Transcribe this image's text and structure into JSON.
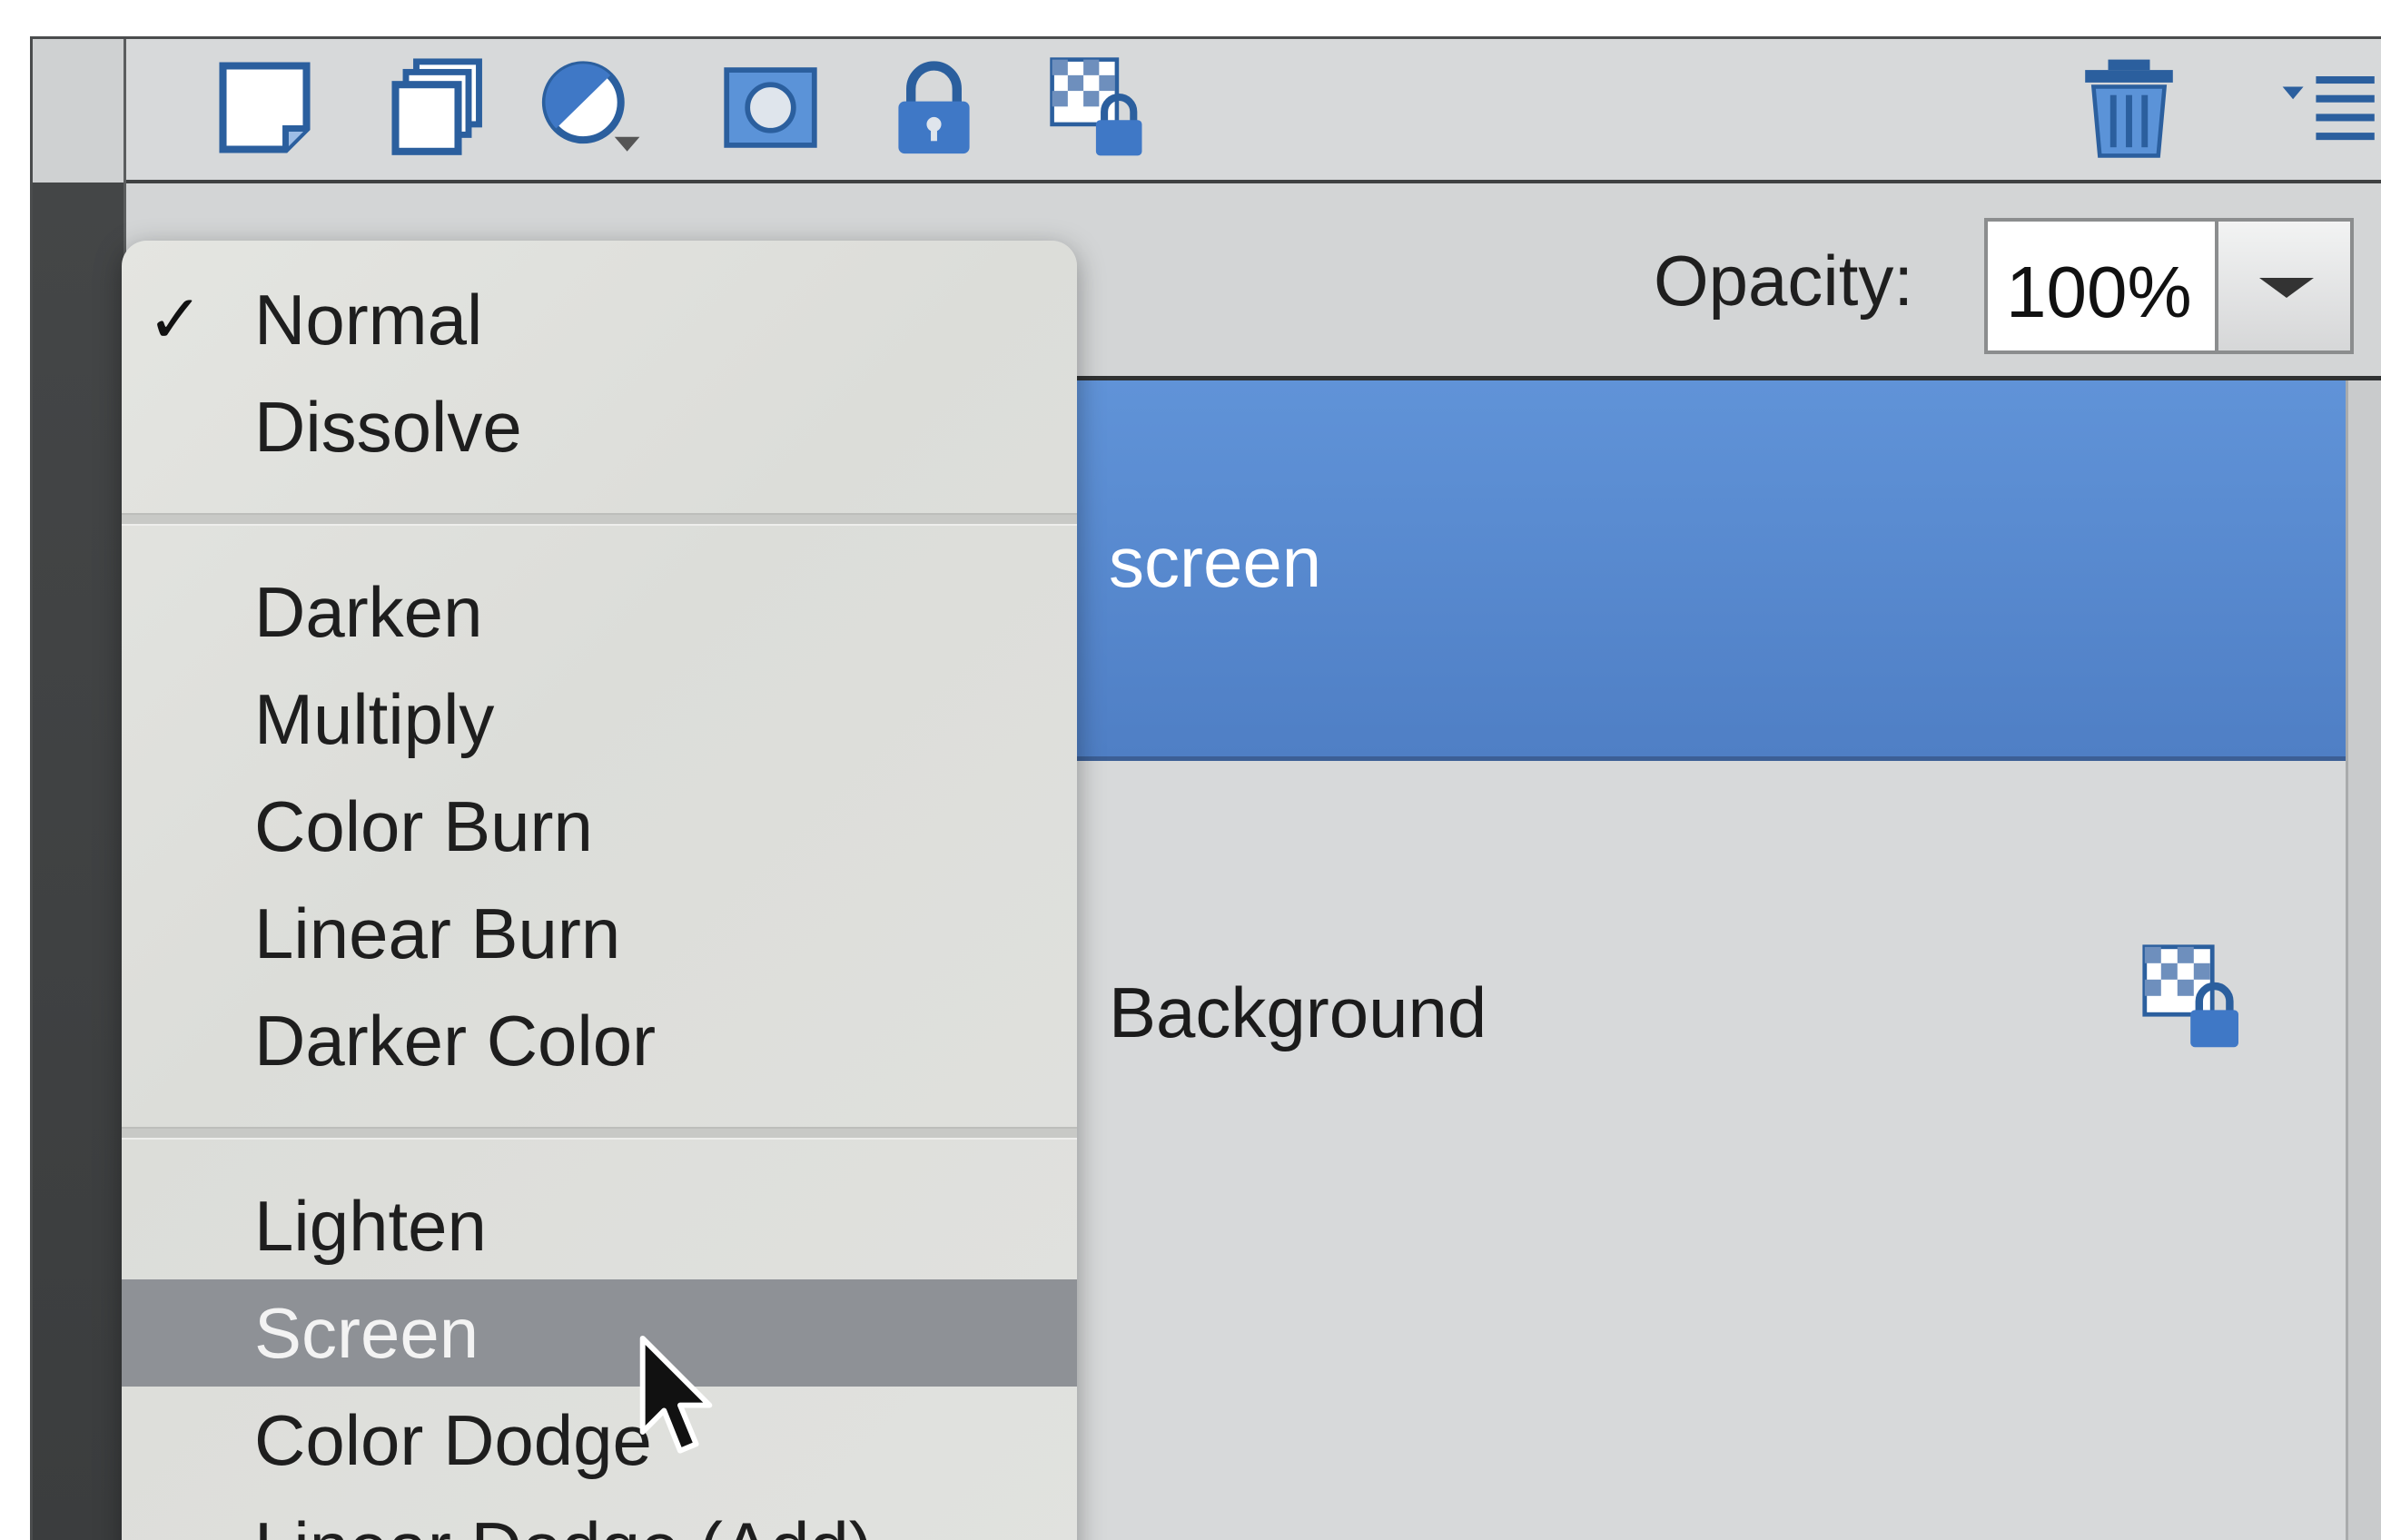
{
  "toolbar": {
    "icons": [
      "new-layer-icon",
      "new-group-icon",
      "adjustment-layer-icon",
      "layer-mask-icon",
      "lock-all-icon",
      "lock-transparency-icon",
      "trash-icon",
      "panel-menu-icon"
    ]
  },
  "options": {
    "opacity_label": "Opacity:",
    "opacity_value": "100%"
  },
  "layers": [
    {
      "name": "screen",
      "selected": true
    },
    {
      "name": "Background",
      "selected": false,
      "locked": true
    }
  ],
  "blend_menu": {
    "checked": "Normal",
    "checkmark": "✓",
    "groups": [
      [
        "Normal",
        "Dissolve"
      ],
      [
        "Darken",
        "Multiply",
        "Color Burn",
        "Linear Burn",
        "Darker Color"
      ],
      [
        "Lighten",
        "Screen",
        "Color Dodge",
        "Linear Dodge (Add)"
      ]
    ],
    "highlighted": "Screen"
  },
  "colors": {
    "selection_blue": "#5a8bd2",
    "menu_highlight": "#8e9196",
    "panel_bg": "#d7d9da"
  }
}
